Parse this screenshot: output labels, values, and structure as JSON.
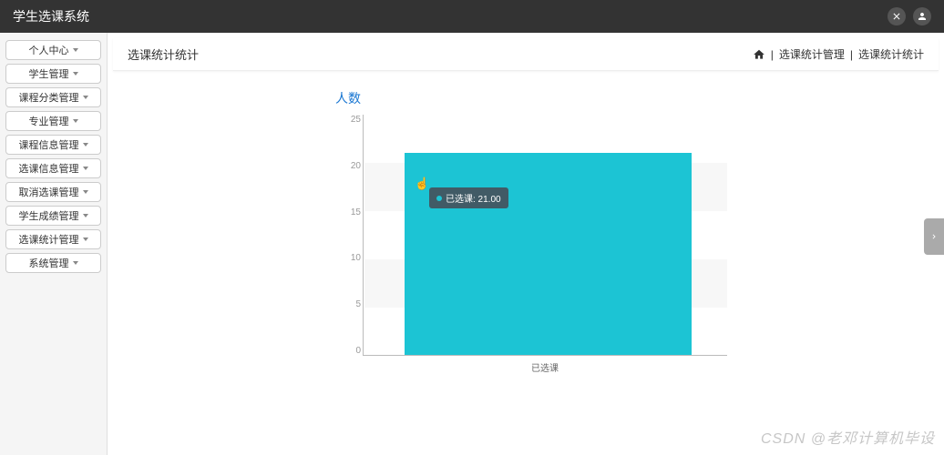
{
  "app_title": "学生选课系统",
  "sidebar": {
    "items": [
      {
        "label": "个人中心"
      },
      {
        "label": "学生管理"
      },
      {
        "label": "课程分类管理"
      },
      {
        "label": "专业管理"
      },
      {
        "label": "课程信息管理"
      },
      {
        "label": "选课信息管理"
      },
      {
        "label": "取消选课管理"
      },
      {
        "label": "学生成绩管理"
      },
      {
        "label": "选课统计管理"
      },
      {
        "label": "系统管理"
      }
    ]
  },
  "header": {
    "page_title": "选课统计统计",
    "breadcrumb": {
      "sep": " | ",
      "item1": "选课统计管理",
      "item2": "选课统计统计"
    }
  },
  "chart_data": {
    "type": "bar",
    "title": "人数",
    "categories": [
      "已选课"
    ],
    "values": [
      21.0
    ],
    "ylabel": "",
    "xlabel": "",
    "ylim": [
      0,
      25
    ],
    "yticks": [
      0,
      5,
      10,
      15,
      20,
      25
    ],
    "tooltip": {
      "label": "已选课",
      "value": "21.00",
      "text": "已选课: 21.00"
    },
    "bar_color": "#1cc4d4"
  },
  "watermark": "CSDN @老邓计算机毕设"
}
